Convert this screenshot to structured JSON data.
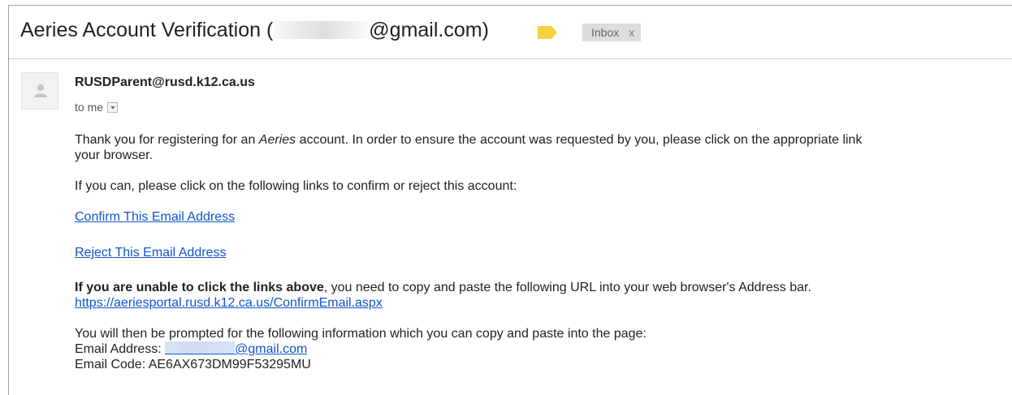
{
  "header": {
    "subject_before": "Aeries Account Verification (",
    "subject_after": "@gmail.com)",
    "label_color": "#f5d142",
    "inbox_label": "Inbox",
    "inbox_close": "x"
  },
  "message": {
    "avatar_icon": "person-icon",
    "sender": "RUSDParent@rusd.k12.ca.us",
    "recipients": "to me",
    "body": {
      "p1_before": "Thank you for registering for an ",
      "p1_em": "Aeries",
      "p1_after": " account. In order to ensure the account was requested by you, please click on the appropriate link",
      "p1_line2": "your browser.",
      "p2": "If you can, please click on the following links to confirm or reject this account:",
      "confirm_link": "Confirm This Email Address",
      "reject_link": "Reject This Email Address",
      "p3_bold": "If you are unable to click the links above",
      "p3_rest": ", you need to copy and paste the following URL into your web browser's Address bar.",
      "url": "https://aeriesportal.rusd.k12.ca.us/ConfirmEmail.aspx",
      "p4": "You will then be prompted for the following information which you can copy and paste into the page:",
      "email_address_label": "Email Address: ",
      "email_address_suffix": "@gmail.com",
      "email_code": "Email Code: AE6AX673DM99F53295MU"
    }
  },
  "colors": {
    "link": "#1155cc",
    "label_bg": "#dddddd",
    "divider": "#d0d0d0"
  }
}
